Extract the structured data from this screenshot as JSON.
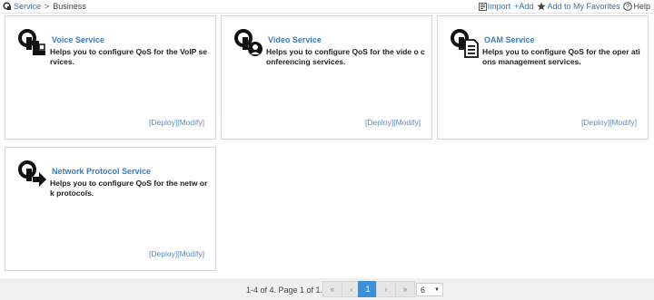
{
  "breadcrumb": {
    "root": "Service",
    "separator": ">",
    "current": "Business"
  },
  "toolbar": {
    "import_label": "Import",
    "add_label": "+Add",
    "favorites_label": "Add to My Favorites",
    "help_label": "Help"
  },
  "cards": [
    {
      "title": "Voice Service",
      "description": "Helps you to configure QoS for the VoIP services.",
      "deploy": "[Deploy]",
      "modify": "[Modify]",
      "icon": "voice-service-icon"
    },
    {
      "title": "Video Service",
      "description": "Helps you to configure QoS for the vide o conferencing services.",
      "deploy": "[Deploy]",
      "modify": "[Modify]",
      "icon": "video-service-icon"
    },
    {
      "title": "OAM Service",
      "description": "Helps you to configure QoS for the oper ations management services.",
      "deploy": "[Deploy]",
      "modify": "[Modify]",
      "icon": "oam-service-icon"
    },
    {
      "title": "Network Protocol Service",
      "description": "Helps you to configure QoS for the netw ork protocols.",
      "deploy": "[Deploy]",
      "modify": "[Modify]",
      "icon": "network-protocol-service-icon"
    }
  ],
  "pagination": {
    "info": "1-4 of 4. Page 1 of 1.",
    "first": "«",
    "prev": "‹",
    "current_page": "1",
    "next": "›",
    "last": "»",
    "page_size": "6",
    "page_size_arrow": "▼"
  },
  "colors": {
    "link": "#2e74b5",
    "active_page": "#3d8fd6",
    "card_border": "#d4d4d4"
  }
}
